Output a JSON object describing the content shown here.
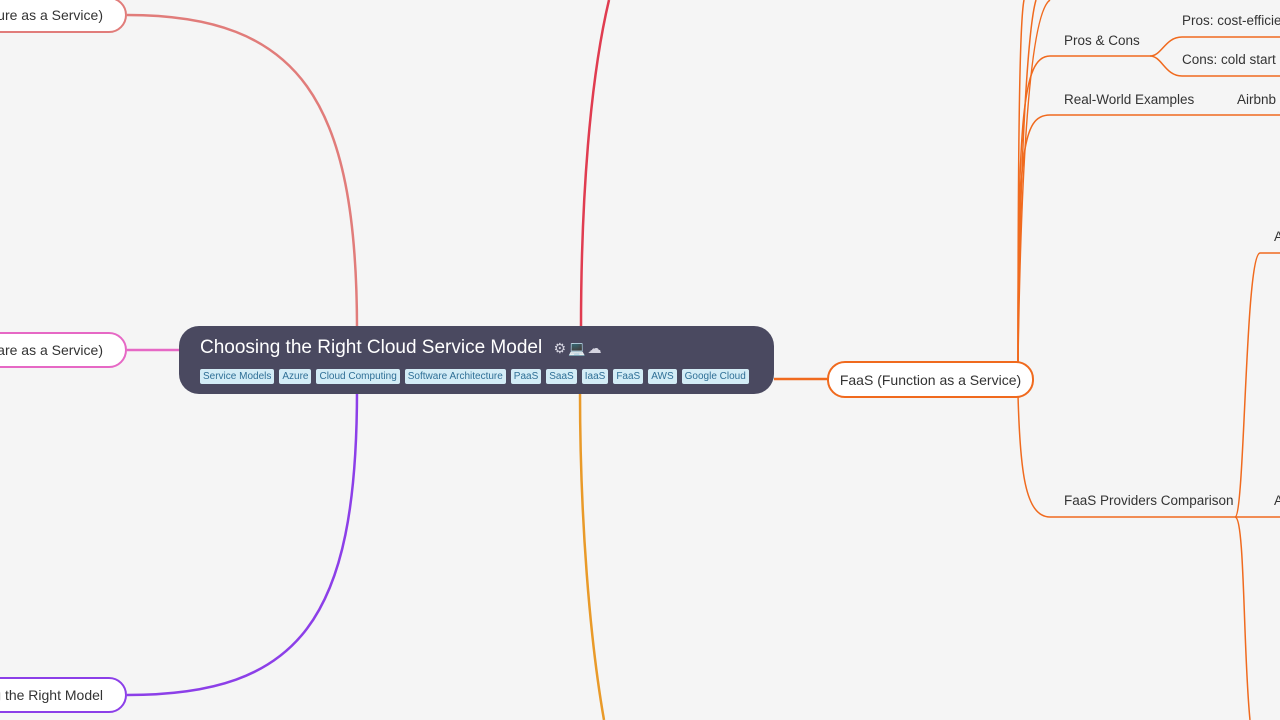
{
  "central": {
    "title": "Choosing the Right Cloud Service Model",
    "icons": [
      "gear-icon",
      "laptop-icon",
      "cloud-icon"
    ],
    "tags": [
      "Service Models",
      "Azure",
      "Cloud Computing",
      "Software Architecture",
      "PaaS",
      "SaaS",
      "IaaS",
      "FaaS",
      "AWS",
      "Google Cloud"
    ]
  },
  "branches": {
    "iaas": "cture as a Service)",
    "saas": "ware as a Service)",
    "choosing": "g the Right Model",
    "faas": "FaaS (Function as a Service)"
  },
  "faas_children": {
    "pros_cons": "Pros & Cons",
    "pros": "Pros: cost-efficie",
    "cons": "Cons: cold start l",
    "examples": "Real-World Examples",
    "examples_child": "Airbnb",
    "providers": "FaaS Providers Comparison",
    "providers_child": "A",
    "upper_child": "A"
  },
  "colors": {
    "background": "#f5f5f5",
    "central": "#4a4960",
    "tag_bg": "#d3ecf6",
    "tag_text": "#2f6f96",
    "iaas": "#e17c7a",
    "saas": "#e668c5",
    "choosing": "#8c3fe8",
    "red_branch": "#e03c50",
    "yellow_branch": "#e99a29",
    "faas": "#f06a1e"
  }
}
